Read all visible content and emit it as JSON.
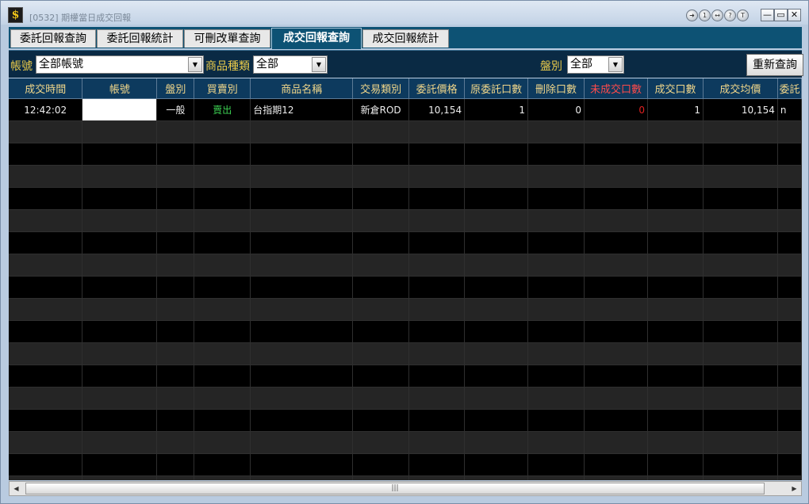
{
  "window": {
    "app_icon": "$",
    "title": "[0532] 期權當日成交回報",
    "title_buttons": [
      "➜",
      "1",
      "↔",
      "?",
      "T"
    ],
    "controls": {
      "minimize": "—",
      "maximize": "▭",
      "close": "✕"
    }
  },
  "tabs": [
    {
      "label": "委託回報查詢",
      "active": false
    },
    {
      "label": "委託回報統計",
      "active": false
    },
    {
      "label": "可刪改單查詢",
      "active": false
    },
    {
      "label": "成交回報查詢",
      "active": true
    },
    {
      "label": "成交回報統計",
      "active": false
    }
  ],
  "filters": {
    "account_label": "帳號",
    "account_value": "全部帳號",
    "product_type_label": "商品種類",
    "product_type_value": "全部",
    "session_label": "盤別",
    "session_value": "全部",
    "requery_label": "重新查詢"
  },
  "table": {
    "headers": [
      "成交時間",
      "帳號",
      "盤別",
      "買賣別",
      "商品名稱",
      "交易類別",
      "委託價格",
      "原委託口數",
      "刪除口數",
      "未成交口數",
      "成交口數",
      "成交均價",
      "委託"
    ],
    "rows": [
      {
        "time": "12:42:02",
        "account": "",
        "session": "一般",
        "side": "賣出",
        "product": "台指期12",
        "trade_type": "新倉ROD",
        "order_price": "10,154",
        "orig_qty": "1",
        "cancel_qty": "0",
        "unfilled_qty": "0",
        "filled_qty": "1",
        "avg_price": "10,154",
        "order_ref": "n"
      }
    ]
  },
  "scrollbar": {
    "left_arrow": "◀",
    "right_arrow": "▶",
    "grip": "|||"
  }
}
